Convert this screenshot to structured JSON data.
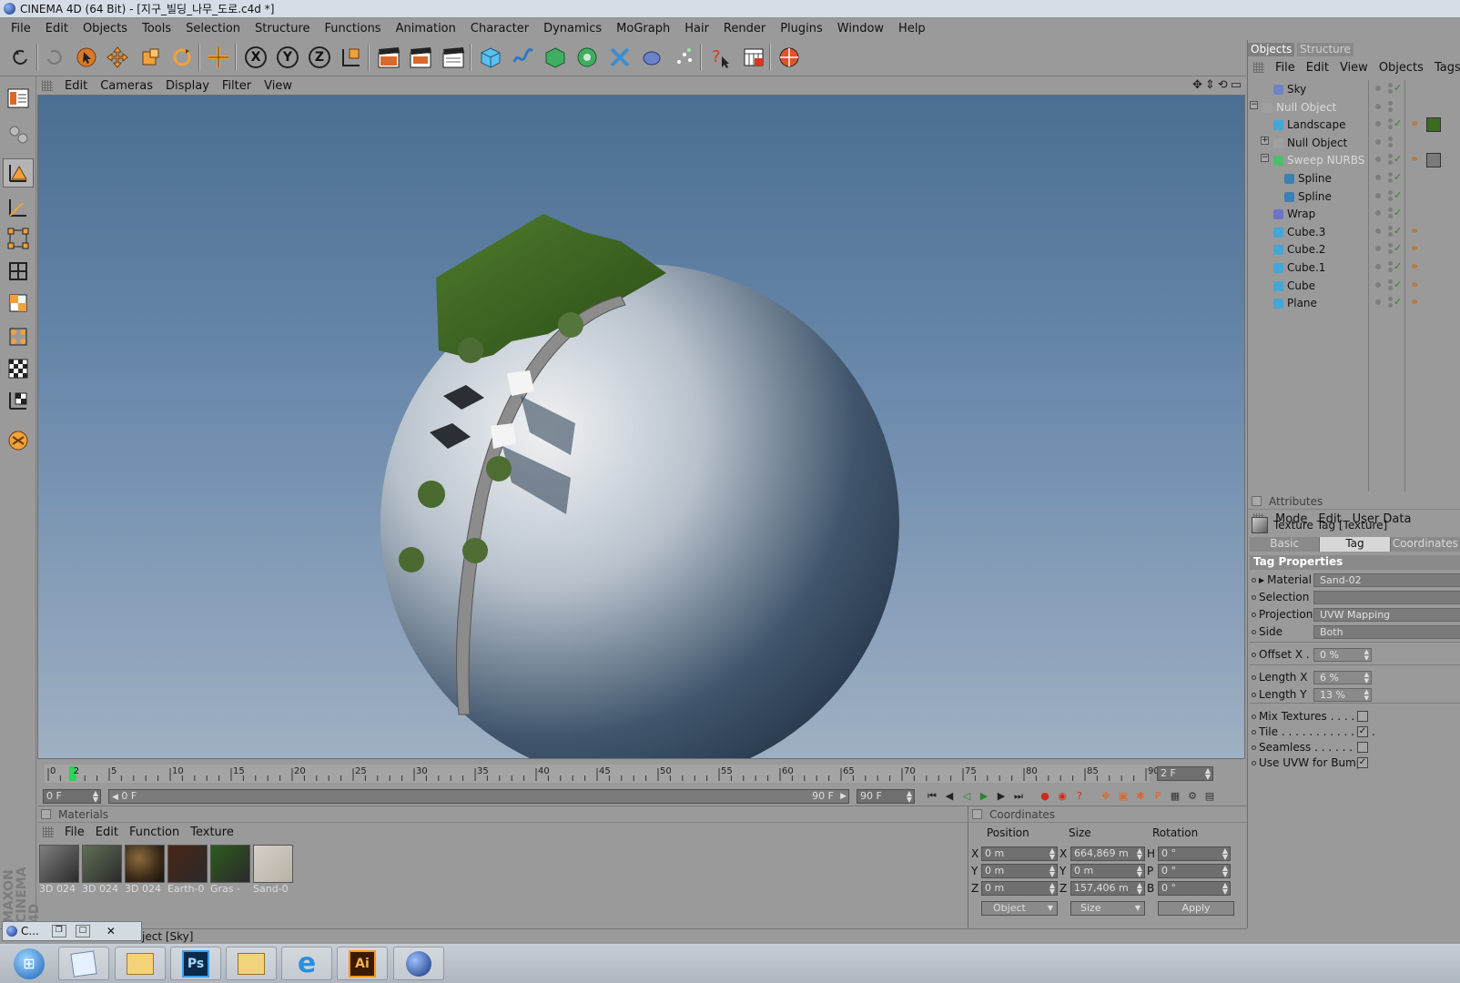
{
  "window": {
    "title": "CINEMA 4D (64 Bit) - [지구_빌딩_나무_도로.c4d *]"
  },
  "menubar": [
    "File",
    "Edit",
    "Objects",
    "Tools",
    "Selection",
    "Structure",
    "Functions",
    "Animation",
    "Character",
    "Dynamics",
    "MoGraph",
    "Hair",
    "Render",
    "Plugins",
    "Window",
    "Help"
  ],
  "toolbar": {
    "icons": [
      "undo-icon",
      "redo-icon",
      "select-cursor-icon",
      "move-icon",
      "scale-icon",
      "rotate-icon",
      "live-move-icon",
      "x-axis-lock-icon",
      "y-axis-lock-icon",
      "z-axis-lock-icon",
      "world-coordinates-icon",
      "render-view-icon",
      "render-picture-viewer-icon",
      "render-settings-icon",
      "cube-primitive-icon",
      "spline-icon",
      "nurbs-icon",
      "array-icon",
      "deformer-icon",
      "environment-icon",
      "particle-icon",
      "help-cursor-icon",
      "timeline-icon",
      "internet-icon"
    ],
    "axis_x": "X",
    "axis_y": "Y",
    "axis_z": "Z"
  },
  "lefttools": [
    "layout-icon",
    "hierarchy-icon",
    "model-mode-icon",
    "object-axis-icon",
    "points-mode-icon",
    "edges-mode-icon",
    "polygons-mode-icon",
    "uv-points-icon",
    "texture-mode-icon",
    "texture-axis-icon",
    "render-toggle-icon"
  ],
  "viewport": {
    "menu": [
      "Edit",
      "Cameras",
      "Display",
      "Filter",
      "View"
    ],
    "nav_icons": [
      "pan-icon",
      "zoom-icon",
      "orbit-icon",
      "maximize-icon"
    ]
  },
  "timeline": {
    "ticks": [
      "0",
      "5",
      "10",
      "15",
      "20",
      "25",
      "30",
      "35",
      "40",
      "45",
      "50",
      "55",
      "60",
      "65",
      "70",
      "75",
      "80",
      "85",
      "90"
    ],
    "current": "2",
    "frame_field": "2 F"
  },
  "transport": {
    "start_field": "0 F",
    "range_start": "0 F",
    "range_end": "90 F",
    "end_field": "90 F"
  },
  "materials": {
    "title": "Materials",
    "menu": [
      "File",
      "Edit",
      "Function",
      "Texture"
    ],
    "items": [
      {
        "name": "3D 024",
        "color": "#7f7f7f"
      },
      {
        "name": "3D 024",
        "color": "#5f6f55"
      },
      {
        "name": "3D 024",
        "color": "#3b2a16"
      },
      {
        "name": "Earth-0",
        "color": "#4a2515"
      },
      {
        "name": "Gras -",
        "color": "#2e5b1e"
      },
      {
        "name": "Sand-0",
        "color": "#b9b2a7"
      }
    ]
  },
  "coordinates": {
    "title": "Coordinates",
    "headers": [
      "Position",
      "Size",
      "Rotation"
    ],
    "rows": [
      {
        "pos_axis": "X",
        "pos": "0 m",
        "size_axis": "X",
        "size": "664,869 m",
        "rot_axis": "H",
        "rot": "0 °"
      },
      {
        "pos_axis": "Y",
        "pos": "0 m",
        "size_axis": "Y",
        "size": "0 m",
        "rot_axis": "P",
        "rot": "0 °"
      },
      {
        "pos_axis": "Z",
        "pos": "0 m",
        "size_axis": "Z",
        "size": "157,406 m",
        "rot_axis": "B",
        "rot": "0 °"
      }
    ],
    "mode": "Object",
    "size_mode": "Size",
    "apply": "Apply"
  },
  "statusbar": {
    "text": "ject [Sky]"
  },
  "objects": {
    "tabs": [
      "Objects",
      "Structure"
    ],
    "menu": [
      "File",
      "Edit",
      "View",
      "Objects",
      "Tags"
    ],
    "items": [
      {
        "name": "Sky",
        "indent": 1,
        "dim": false,
        "icon_color": "#6c84c8",
        "check": true,
        "tags": []
      },
      {
        "name": "Null Object",
        "indent": 0,
        "dim": true,
        "icon_color": "#a0a0a0",
        "check": false,
        "tags": []
      },
      {
        "name": "Landscape",
        "indent": 1,
        "dim": false,
        "icon_color": "#44a6d6",
        "check": true,
        "tags": [
          "texture",
          "green"
        ]
      },
      {
        "name": "Null Object",
        "indent": 1,
        "dim": false,
        "icon_color": "#a0a0a0",
        "check": false,
        "tags": []
      },
      {
        "name": "Sweep NURBS",
        "indent": 1,
        "dim": true,
        "icon_color": "#4cbf6a",
        "check": true,
        "tags": [
          "texture",
          "grey"
        ]
      },
      {
        "name": "Spline",
        "indent": 2,
        "dim": false,
        "icon_color": "#3e7fb5",
        "check": true,
        "tags": []
      },
      {
        "name": "Spline",
        "indent": 2,
        "dim": false,
        "icon_color": "#3e7fb5",
        "check": true,
        "tags": []
      },
      {
        "name": "Wrap",
        "indent": 1,
        "dim": false,
        "icon_color": "#6f74c8",
        "check": true,
        "tags": []
      },
      {
        "name": "Cube.3",
        "indent": 1,
        "dim": false,
        "icon_color": "#44a6d6",
        "check": true,
        "tags": [
          "texture"
        ]
      },
      {
        "name": "Cube.2",
        "indent": 1,
        "dim": false,
        "icon_color": "#44a6d6",
        "check": true,
        "tags": [
          "texture"
        ]
      },
      {
        "name": "Cube.1",
        "indent": 1,
        "dim": false,
        "icon_color": "#44a6d6",
        "check": true,
        "tags": [
          "texture"
        ]
      },
      {
        "name": "Cube",
        "indent": 1,
        "dim": false,
        "icon_color": "#44a6d6",
        "check": true,
        "tags": [
          "texture"
        ]
      },
      {
        "name": "Plane",
        "indent": 1,
        "dim": false,
        "icon_color": "#44a6d6",
        "check": true,
        "tags": [
          "texture"
        ]
      }
    ]
  },
  "attributes": {
    "title": "Attributes",
    "menu": [
      "Mode",
      "Edit",
      "User Data"
    ],
    "object_label": "Texture Tag [Texture]",
    "tabs": [
      "Basic",
      "Tag",
      "Coordinates"
    ],
    "section": "Tag Properties",
    "props": [
      {
        "label": "Material",
        "value": "Sand-02"
      },
      {
        "label": "Selection",
        "value": ""
      },
      {
        "label": "Projection",
        "value": "UVW Mapping"
      },
      {
        "label": "Side",
        "value": "Both"
      }
    ],
    "offset_x": {
      "label": "Offset X . .",
      "value": "0 %"
    },
    "length_x": {
      "label": "Length X",
      "value": "6 %"
    },
    "length_y": {
      "label": "Length Y",
      "value": "13 %"
    },
    "checks": [
      {
        "label": "Mix Textures . . . . .",
        "checked": false
      },
      {
        "label": "Tile . . . . . . . . . . . . . .",
        "checked": true
      },
      {
        "label": "Seamless . . . . . . . .",
        "checked": false
      },
      {
        "label": "Use UVW for Bump",
        "checked": true
      }
    ]
  },
  "corner_window": {
    "label": "C..."
  },
  "taskbar": {
    "apps": [
      "windows-start-icon",
      "notes-icon",
      "explorer-icon",
      "photoshop-icon",
      "folder-icon",
      "internet-explorer-icon",
      "illustrator-icon",
      "cinema4d-icon"
    ],
    "ps": "Ps",
    "ai": "Ai"
  }
}
